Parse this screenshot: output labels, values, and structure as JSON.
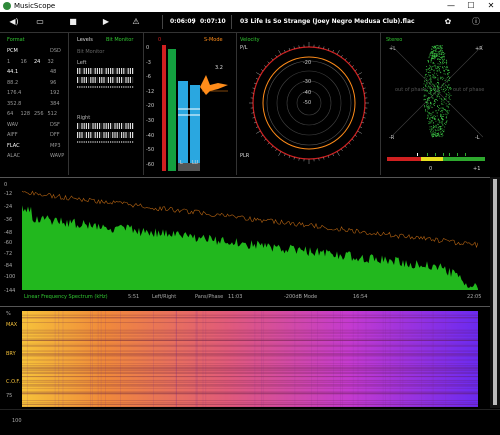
{
  "window": {
    "title": "MusicScope",
    "minimize": "—",
    "maximize": "☐",
    "close": "✕"
  },
  "toolbar": {
    "current_time": "0:06:09",
    "total_time": "0:07:10",
    "track": "03 Life Is So Strange (Joey Negro Medusa Club).flac",
    "icons": [
      "volume-icon",
      "folder-icon",
      "stop-icon",
      "play-icon",
      "tuner-icon",
      "settings-icon",
      "info-icon"
    ]
  },
  "format_panel": {
    "title": "Format",
    "rows": [
      [
        "PCM",
        "DSD"
      ],
      [
        "1",
        "16",
        "24",
        "32"
      ],
      [
        "44.1",
        "48"
      ],
      [
        "88.2",
        "96"
      ],
      [
        "176.4",
        "192"
      ],
      [
        "352.8",
        "384"
      ],
      [
        "64",
        "128",
        "256",
        "512"
      ],
      [
        "WAV",
        "DSF"
      ],
      [
        "AIFF",
        "DFF"
      ],
      [
        "FLAC",
        "MP3"
      ],
      [
        "ALAC",
        "WAVP"
      ]
    ]
  },
  "levels_panel": {
    "title": "Levels",
    "mode": "Bit Monitor",
    "sub": "Bit Monitor",
    "left": "Left",
    "right": "Right"
  },
  "meter_panel": {
    "title": "S-Mode",
    "top_label": "0",
    "scale": [
      "0",
      "-3",
      "-6",
      "-12",
      "-20",
      "-30",
      "-40",
      "-50",
      "-60"
    ],
    "peak_value": "3.2",
    "meter_labels": [
      "L",
      "LU"
    ]
  },
  "velocity_panel": {
    "title": "Velocity",
    "top_label": "P/L",
    "bottom_label": "PLR",
    "rings": [
      "-20",
      "-30",
      "-40",
      "-50"
    ]
  },
  "stereo_panel": {
    "title": "Stereo",
    "top_left": "+L",
    "top_right": "+R",
    "mid_left": "-R",
    "mid_right": "-L",
    "out_phase_left": "out of phase",
    "out_phase_right": "out of phase",
    "corr_left": "0",
    "corr_right": "+1"
  },
  "spectrum": {
    "y_ticks": [
      "0",
      "-12",
      "-24",
      "-36",
      "-48",
      "-60",
      "-72",
      "-84",
      "-100",
      "-144"
    ],
    "x_ticks": [
      "5:51",
      "11:03",
      "16:54",
      "22:05"
    ],
    "label": "Linear Frequency Spectrum (kHz)",
    "mode_left": "Left/Right",
    "mode_mid": "Pans/Phase",
    "mode_right": "-200dB Mode"
  },
  "spectrogram": {
    "y_labels": [
      "%",
      "MAX",
      "",
      "BRY",
      "",
      "C.O.F.",
      "75"
    ],
    "scale_label": "100"
  },
  "colors": {
    "green": "#31c832",
    "orange": "#ff8c1a",
    "red": "#d02020",
    "blue": "#2aa7e0",
    "magenta": "#d42fb0"
  }
}
